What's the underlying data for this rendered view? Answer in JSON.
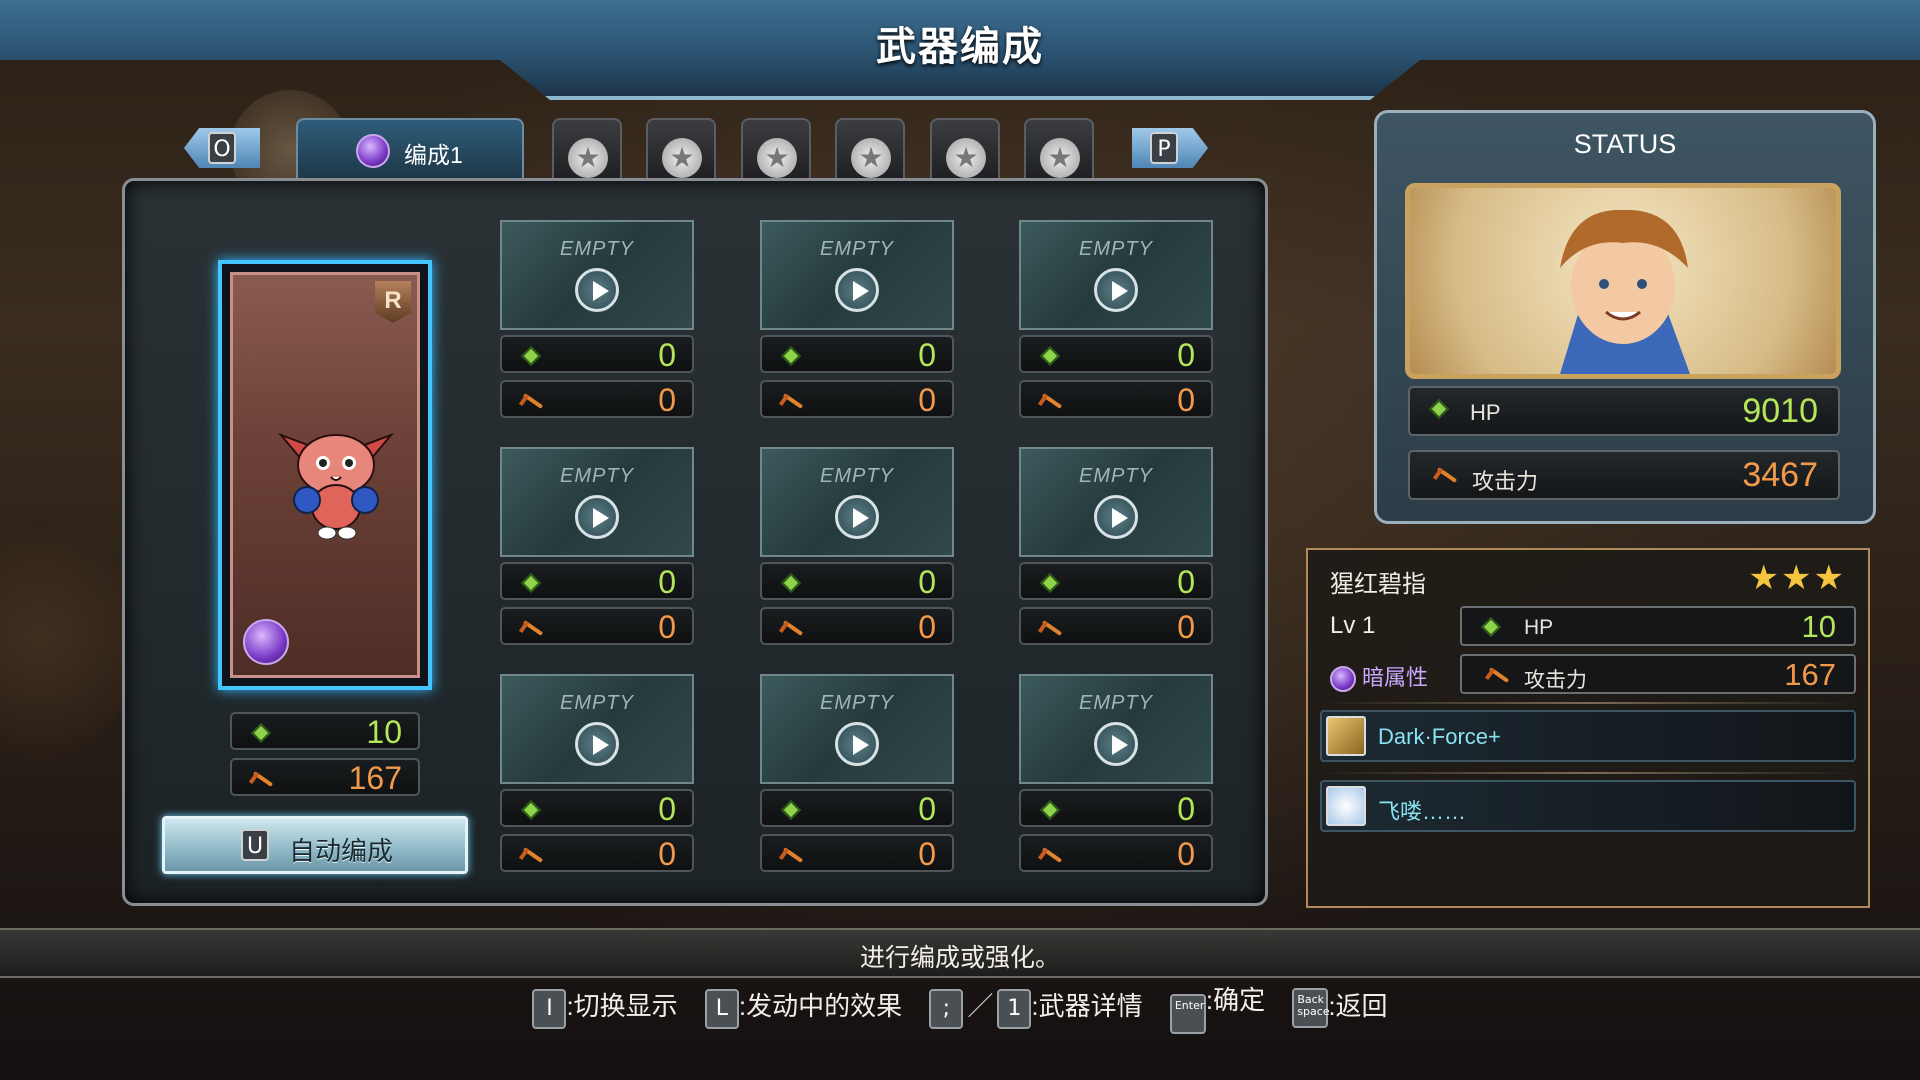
{
  "title": "武器编成",
  "nav": {
    "prev_key": "O",
    "next_key": "P",
    "formation_tab_label": "编成1"
  },
  "main_weapon": {
    "rarity": "R",
    "hp": "10",
    "atk": "167"
  },
  "auto_formation": {
    "key": "U",
    "label": "自动编成"
  },
  "slots": [
    {
      "label": "EMPTY",
      "hp": "0",
      "atk": "0"
    },
    {
      "label": "EMPTY",
      "hp": "0",
      "atk": "0"
    },
    {
      "label": "EMPTY",
      "hp": "0",
      "atk": "0"
    },
    {
      "label": "EMPTY",
      "hp": "0",
      "atk": "0"
    },
    {
      "label": "EMPTY",
      "hp": "0",
      "atk": "0"
    },
    {
      "label": "EMPTY",
      "hp": "0",
      "atk": "0"
    },
    {
      "label": "EMPTY",
      "hp": "0",
      "atk": "0"
    },
    {
      "label": "EMPTY",
      "hp": "0",
      "atk": "0"
    },
    {
      "label": "EMPTY",
      "hp": "0",
      "atk": "0"
    }
  ],
  "status": {
    "title": "STATUS",
    "hp_label": "HP",
    "hp_value": "9010",
    "atk_label": "攻击力",
    "atk_value": "3467"
  },
  "weapon_detail": {
    "name": "猩红碧指",
    "stars": "★★★",
    "level": "Lv 1",
    "element": "暗属性",
    "hp_label": "HP",
    "hp_value": "10",
    "atk_label": "攻击力",
    "atk_value": "167",
    "skills": [
      {
        "name": "Dark·Force+",
        "icon": "sword-skill-icon"
      },
      {
        "name": "飞喽……",
        "icon": "clock-skill-icon"
      }
    ]
  },
  "hint": "进行编成或强化。",
  "controls": {
    "toggle_key": "I",
    "toggle_label": ":切换显示",
    "effects_key": "L",
    "effects_label": ":发动中的效果",
    "detail_key1": ";",
    "detail_sep": "／",
    "detail_key2": "1",
    "detail_label": ":武器详情",
    "confirm_key": "Enter",
    "confirm_label": ":确定",
    "back_key": "Back space",
    "back_label": ":返回"
  },
  "colors": {
    "hp": "#b4e65a",
    "atk": "#f2994a",
    "selection": "#43c6ff",
    "title_bar": "#3e6f92"
  }
}
